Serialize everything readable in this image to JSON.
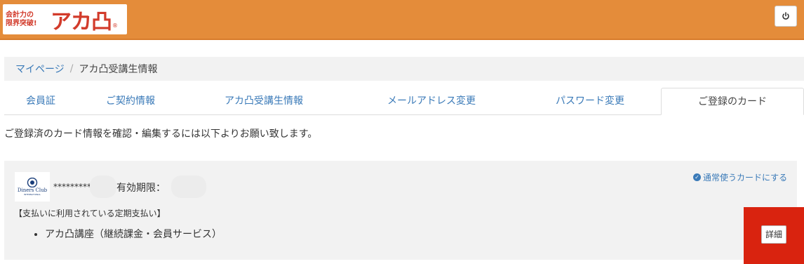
{
  "header": {
    "logo": {
      "tagline_line1": "会計力の",
      "tagline_line2": "限界突破!",
      "wordmark": "アカ凸",
      "reg_mark": "®"
    },
    "power_button_icon": "power-icon",
    "brand_color": "#e48c3a"
  },
  "breadcrumb": {
    "items": [
      "マイページ",
      "アカ凸受講生情報"
    ],
    "separator": "/"
  },
  "tabs": [
    {
      "label": "会員証",
      "active": false
    },
    {
      "label": "ご契約情報",
      "active": false
    },
    {
      "label": "アカ凸受講生情報",
      "active": false
    },
    {
      "label": "メールアドレス変更",
      "active": false
    },
    {
      "label": "パスワード変更",
      "active": false
    },
    {
      "label": "ご登録のカード",
      "active": true
    }
  ],
  "intro_text": "ご登録済のカード情報を確認・編集するには以下よりお願い致します。",
  "card": {
    "brand_logo": {
      "name": "Diners Club",
      "sub": "INTERNATIONAL"
    },
    "masked_number": "*********",
    "expiry_label": "有効期限：",
    "set_default_label": "通常使うカードにする",
    "payments_heading": "【支払いに利用されている定期支払い】",
    "payments": [
      "アカ凸講座（継続課金・会員サービス）"
    ],
    "detail_button": "詳細"
  },
  "colors": {
    "link": "#3a7ab8",
    "highlight": "#d9230f"
  }
}
